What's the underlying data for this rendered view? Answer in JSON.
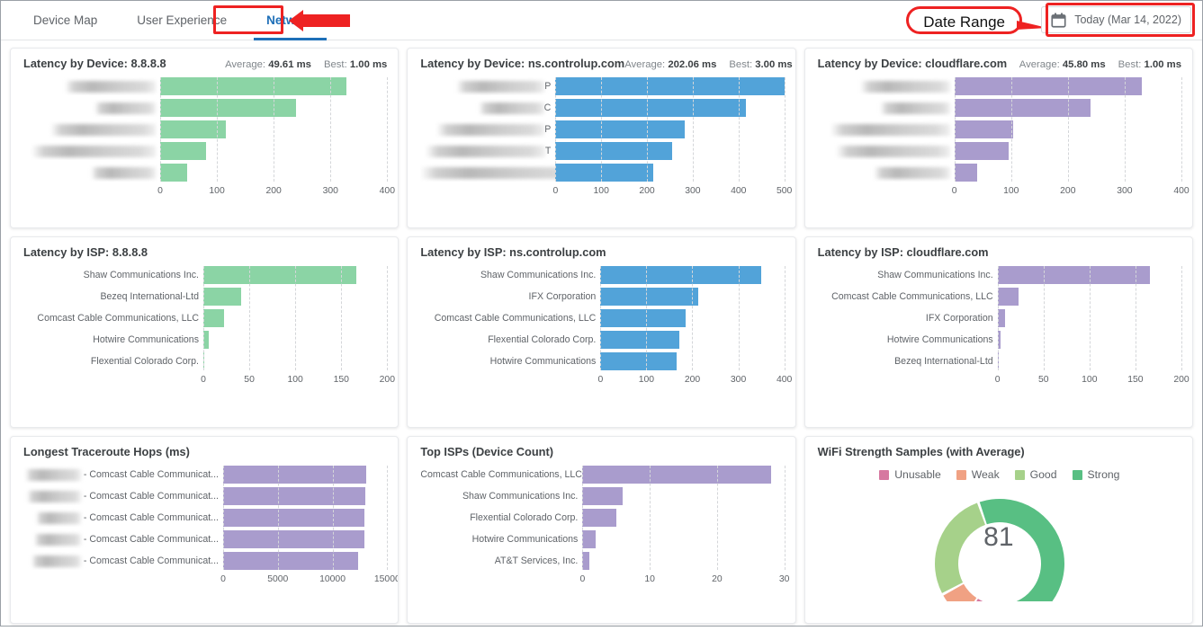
{
  "tabs": [
    {
      "label": "Device Map",
      "active": false
    },
    {
      "label": "User Experience",
      "active": false
    },
    {
      "label": "Network",
      "active": true
    }
  ],
  "annotations": {
    "date_range_callout": "Date Range"
  },
  "date_range": {
    "icon": "calendar-icon",
    "value": "Today (Mar 14, 2022)"
  },
  "colors": {
    "green": "#8bd4a5",
    "blue": "#52a3d9",
    "purple": "#a99ccd",
    "unusable": "#d678a0",
    "weak": "#f0a183",
    "good": "#a6d18a",
    "strong": "#58bf83",
    "accent": "#1e6fb8",
    "annotation_red": "#ee2222"
  },
  "stat_labels": {
    "average": "Average:",
    "best": "Best:"
  },
  "chart_data": [
    {
      "id": "latency-by-device-8888",
      "type": "bar",
      "orientation": "horizontal",
      "title": "Latency by Device: 8.8.8.8",
      "stats": {
        "average": "49.61 ms",
        "best": "1.00 ms"
      },
      "color": "#8bd4a5",
      "categories": [
        "[redacted]",
        "[redacted]",
        "[redacted]",
        "[redacted]",
        "[redacted]"
      ],
      "redacted_label_widths": [
        101,
        68,
        117,
        138,
        72
      ],
      "values": [
        328,
        240,
        116,
        81,
        48
      ],
      "ticks": [
        0,
        100,
        200,
        300,
        400
      ],
      "xlim": [
        0,
        400
      ],
      "xlabel": "",
      "ylabel": "",
      "grid": true
    },
    {
      "id": "latency-by-device-nscontrolup",
      "type": "bar",
      "orientation": "horizontal",
      "title": "Latency by Device: ns.controlup.com",
      "stats": {
        "average": "202.06 ms",
        "best": "3.00 ms"
      },
      "color": "#52a3d9",
      "categories": [
        "[redacted]P",
        "[redacted]C",
        "[redacted]P",
        "[redacted]T",
        "[redacted]L"
      ],
      "redacted_label_widths": [
        98,
        73,
        120,
        133,
        177
      ],
      "values": [
        500,
        417,
        282,
        255,
        214
      ],
      "ticks": [
        0,
        100,
        200,
        300,
        400,
        500
      ],
      "xlim": [
        0,
        500
      ],
      "xlabel": "",
      "ylabel": "",
      "grid": true
    },
    {
      "id": "latency-by-device-cloudflare",
      "type": "bar",
      "orientation": "horizontal",
      "title": "Latency by Device: cloudflare.com",
      "stats": {
        "average": "45.80 ms",
        "best": "1.00 ms"
      },
      "color": "#a99ccd",
      "categories": [
        "[redacted]",
        "[redacted]",
        "[redacted]",
        "[redacted]",
        "[redacted]"
      ],
      "redacted_label_widths": [
        100,
        78,
        133,
        127,
        85
      ],
      "values": [
        330,
        240,
        103,
        95,
        40
      ],
      "ticks": [
        0,
        100,
        200,
        300,
        400
      ],
      "xlim": [
        0,
        400
      ],
      "xlabel": "",
      "ylabel": "",
      "grid": true
    },
    {
      "id": "latency-by-isp-8888",
      "type": "bar",
      "orientation": "horizontal",
      "title": "Latency by ISP: 8.8.8.8",
      "color": "#8bd4a5",
      "categories": [
        "Shaw Communications Inc.",
        "Bezeq International-Ltd",
        "Comcast Cable Communications, LLC",
        "Hotwire Communications",
        "Flexential Colorado Corp."
      ],
      "values": [
        166,
        41,
        23,
        6,
        1
      ],
      "ticks": [
        0,
        50,
        100,
        150,
        200
      ],
      "xlim": [
        0,
        200
      ],
      "xlabel": "",
      "ylabel": "",
      "grid": true
    },
    {
      "id": "latency-by-isp-nscontrolup",
      "type": "bar",
      "orientation": "horizontal",
      "title": "Latency by ISP: ns.controlup.com",
      "color": "#52a3d9",
      "categories": [
        "Shaw Communications Inc.",
        "IFX Corporation",
        "Comcast Cable Communications, LLC",
        "Flexential Colorado Corp.",
        "Hotwire Communications"
      ],
      "values": [
        350,
        213,
        186,
        172,
        165
      ],
      "ticks": [
        0,
        100,
        200,
        300,
        400
      ],
      "xlim": [
        0,
        400
      ],
      "xlabel": "",
      "ylabel": "",
      "grid": true
    },
    {
      "id": "latency-by-isp-cloudflare",
      "type": "bar",
      "orientation": "horizontal",
      "title": "Latency by ISP: cloudflare.com",
      "color": "#a99ccd",
      "categories": [
        "Shaw Communications Inc.",
        "Comcast Cable Communications, LLC",
        "IFX Corporation",
        "Hotwire Communications",
        "Bezeq International-Ltd"
      ],
      "values": [
        166,
        23,
        8,
        3,
        1
      ],
      "ticks": [
        0,
        50,
        100,
        150,
        200
      ],
      "xlim": [
        0,
        200
      ],
      "xlabel": "",
      "ylabel": "",
      "grid": true
    },
    {
      "id": "longest-traceroute-hops",
      "type": "bar",
      "orientation": "horizontal",
      "title": "Longest Traceroute Hops (ms)",
      "color": "#a99ccd",
      "categories": [
        "[redacted] - Comcast Cable Communicat...",
        "[redacted] - Comcast Cable Communicat...",
        "[redacted] - Comcast Cable Communicat...",
        "[redacted] - Comcast Cable Communicat...",
        "[redacted] - Comcast Cable Communicat..."
      ],
      "redacted_label_widths": [
        62,
        60,
        50,
        52,
        55
      ],
      "suffix_label": "- Comcast Cable Communicat...",
      "values": [
        13100,
        12980,
        12950,
        12880,
        12350
      ],
      "ticks": [
        0,
        5000,
        10000,
        15000
      ],
      "xlim": [
        0,
        15000
      ],
      "xlabel": "",
      "ylabel": "",
      "grid": true
    },
    {
      "id": "top-isps-device-count",
      "type": "bar",
      "orientation": "horizontal",
      "title": "Top ISPs (Device Count)",
      "color": "#a99ccd",
      "categories": [
        "Comcast Cable Communications, LLC",
        "Shaw Communications Inc.",
        "Flexential Colorado Corp.",
        "Hotwire Communications",
        "AT&T Services, Inc."
      ],
      "values": [
        28,
        6,
        5,
        2,
        1
      ],
      "ticks": [
        0,
        10,
        20,
        30
      ],
      "xlim": [
        0,
        30
      ],
      "xlabel": "",
      "ylabel": "",
      "grid": true
    },
    {
      "id": "wifi-strength-samples",
      "type": "pie",
      "variant": "gauge-donut",
      "title": "WiFi Strength Samples (with Average)",
      "center_value": "81",
      "legend_position": "top",
      "labels": [
        "Unusable",
        "Weak",
        "Good",
        "Strong"
      ],
      "colors": [
        "#d678a0",
        "#f0a183",
        "#a6d18a",
        "#58bf83"
      ],
      "values": [
        4,
        9,
        31,
        56
      ]
    }
  ]
}
